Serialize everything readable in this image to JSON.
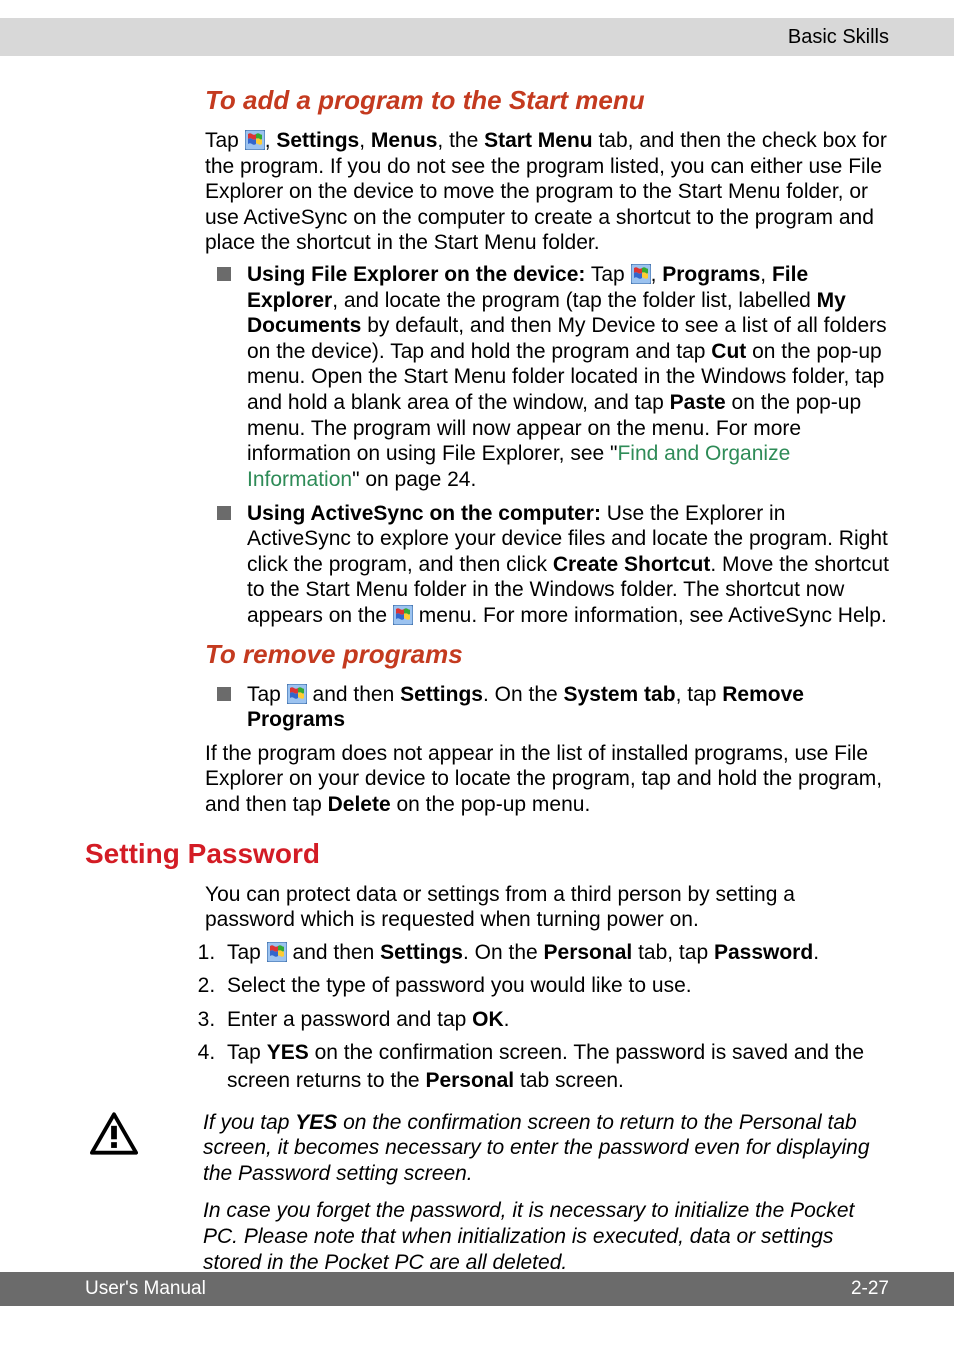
{
  "header": {
    "section": "Basic Skills"
  },
  "s1": {
    "heading": "To add a program to the Start menu",
    "intro_1": "Tap ",
    "intro_2": ", ",
    "settings": "Settings",
    "intro_3": ", ",
    "menus": "Menus",
    "intro_4": ", the ",
    "startmenu": "Start Menu",
    "intro_5": " tab, and then the check box for the program. If you do not see the program listed, you can either use File Explorer on the device to move the program to the Start Menu folder, or use ActiveSync on the computer to create a shortcut to the program and place the shortcut in the Start Menu folder.",
    "item1": {
      "lead": "Using File Explorer on the device:",
      "t1": " Tap ",
      "t2": ", ",
      "programs": "Programs",
      "t3": ", ",
      "fe": "File Explorer",
      "t4": ", and locate the program (tap the folder list, labelled ",
      "mydocs": "My Documents",
      "t5": " by default, and then My Device to see a list of all folders on the device). Tap and hold the program and tap ",
      "cut": "Cut",
      "t6": " on the pop-up menu. Open the Start Menu folder located in the Windows folder, tap and hold a blank area of the window, and tap ",
      "paste": "Paste",
      "t7": " on the pop-up menu. The program will now appear on the menu. For more information on using File Explorer, see \"",
      "link": "Find and Organize Information",
      "t8": "\" on page 24."
    },
    "item2": {
      "lead": "Using ActiveSync on the computer:",
      "t1": " Use the Explorer in ActiveSync to explore your device files and locate the program. Right click the program, and then click ",
      "cs": "Create Shortcut",
      "t2": ". Move the shortcut to the Start Menu folder in the Windows folder. The shortcut now appears on the ",
      "t3": " menu. For more information, see ActiveSync Help."
    }
  },
  "s2": {
    "heading": "To remove programs",
    "item": {
      "t1": "Tap ",
      "t2": " and then ",
      "settings": "Settings",
      "t3": ". On the ",
      "systab": "System tab",
      "t4": ", tap ",
      "rp": "Remove Programs"
    },
    "para_1": "If the program does not appear in the list of installed programs, use File Explorer on your device to locate the program, tap and hold the program, and then tap ",
    "delete": "Delete",
    "para_2": " on the pop-up menu."
  },
  "s3": {
    "heading": "Setting Password",
    "intro": "You can protect data or settings from a third person by setting a password which is requested when turning power on.",
    "steps": {
      "s1a": "Tap ",
      "s1b": " and then ",
      "s1_settings": "Settings",
      "s1c": ". On the ",
      "s1_personal": "Personal",
      "s1d": " tab, tap ",
      "s1_password": "Password",
      "s1e": ".",
      "s2": "Select the type of password you would like to use.",
      "s3a": "Enter a password and tap ",
      "s3_ok": "OK",
      "s3b": ".",
      "s4a": "Tap ",
      "s4_yes": "YES",
      "s4b": " on the confirmation screen. The password is saved and the screen returns to the ",
      "s4_personal": "Personal",
      "s4c": " tab screen."
    },
    "caution": {
      "p1a": "If you tap ",
      "p1_yes": "YES",
      "p1b": " on the confirmation screen to return to the Personal tab screen, it becomes necessary to enter the password even for displaying the Password setting screen.",
      "p2": "In case you forget the password, it is necessary to initialize the Pocket PC. Please note that when initialization is executed, data or settings stored in the Pocket PC are all deleted."
    }
  },
  "footer": {
    "left": "User's Manual",
    "right": "2-27"
  }
}
